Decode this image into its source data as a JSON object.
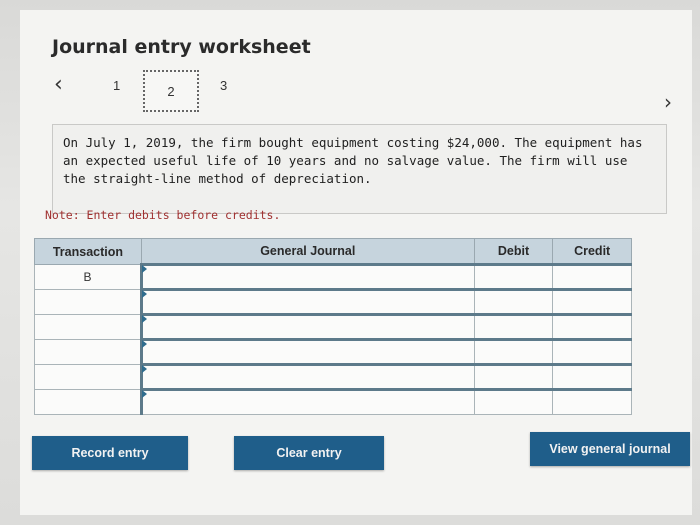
{
  "header": {
    "title": "Journal entry worksheet"
  },
  "pager": {
    "prev_icon": "‹",
    "next_icon": "›",
    "steps": [
      "1",
      "2",
      "3"
    ],
    "current_step": "2"
  },
  "problem": {
    "text": "On July 1, 2019, the firm bought equipment costing $24,000. The equipment has an expected useful life of 10 years and no salvage value. The firm will use the straight-line method of depreciation."
  },
  "note": "Note: Enter debits before credits.",
  "journal_table": {
    "headers": {
      "transaction": "Transaction",
      "general_journal": "General Journal",
      "debit": "Debit",
      "credit": "Credit"
    },
    "rows": [
      {
        "transaction": "B",
        "account": "",
        "debit": "",
        "credit": ""
      },
      {
        "transaction": "",
        "account": "",
        "debit": "",
        "credit": ""
      },
      {
        "transaction": "",
        "account": "",
        "debit": "",
        "credit": ""
      },
      {
        "transaction": "",
        "account": "",
        "debit": "",
        "credit": ""
      },
      {
        "transaction": "",
        "account": "",
        "debit": "",
        "credit": ""
      },
      {
        "transaction": "",
        "account": "",
        "debit": "",
        "credit": ""
      }
    ]
  },
  "buttons": {
    "record": "Record entry",
    "clear": "Clear entry",
    "view": "View general journal"
  },
  "colors": {
    "button": "#1f5e8a",
    "header_bg": "#c6d4dd",
    "note": "#a03030"
  }
}
